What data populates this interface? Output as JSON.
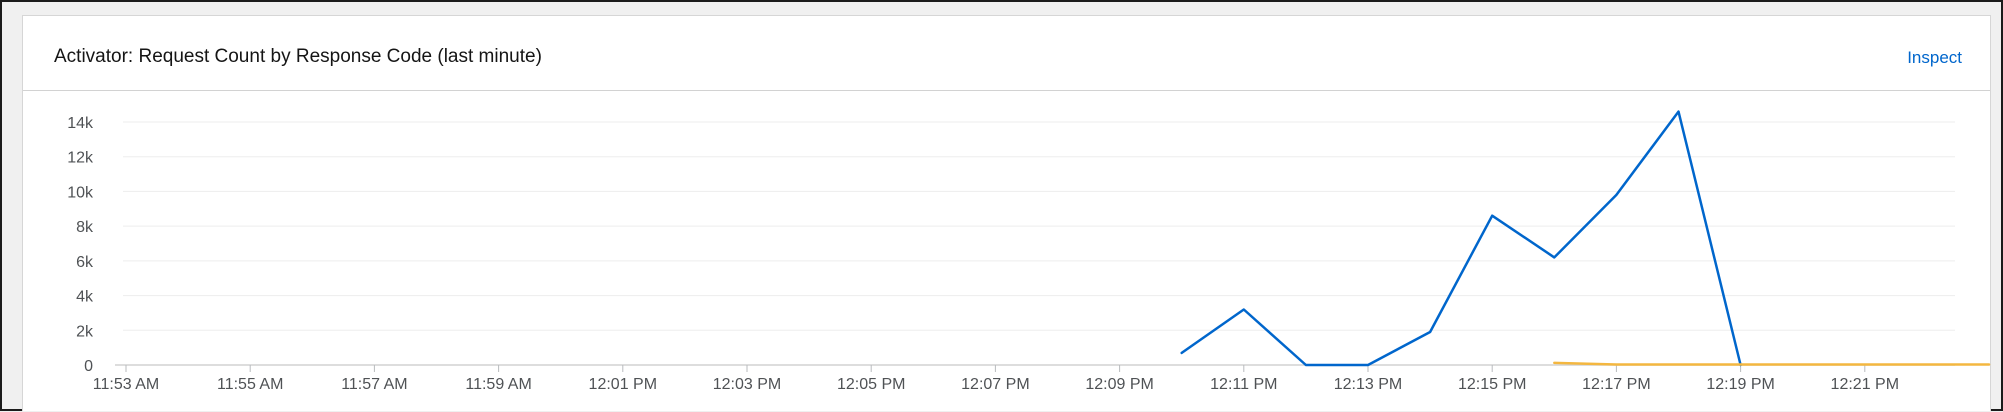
{
  "card": {
    "title": "Activator: Request Count by Response Code (last minute)",
    "inspect_label": "Inspect"
  },
  "colors": {
    "series_blue": "#0066cc",
    "series_orange": "#f4b740",
    "grid": "#ededed",
    "link": "#0066cc"
  },
  "chart_data": {
    "type": "line",
    "title": "Activator: Request Count by Response Code (last minute)",
    "xlabel": "",
    "ylabel": "",
    "ylim": [
      0,
      14000
    ],
    "y_ticks": [
      {
        "value": 0,
        "label": "0"
      },
      {
        "value": 2000,
        "label": "2k"
      },
      {
        "value": 4000,
        "label": "4k"
      },
      {
        "value": 6000,
        "label": "6k"
      },
      {
        "value": 8000,
        "label": "8k"
      },
      {
        "value": 10000,
        "label": "10k"
      },
      {
        "value": 12000,
        "label": "12k"
      },
      {
        "value": 14000,
        "label": "14k"
      }
    ],
    "x_ticks": [
      "11:53 AM",
      "11:55 AM",
      "11:57 AM",
      "11:59 AM",
      "12:01 PM",
      "12:03 PM",
      "12:05 PM",
      "12:07 PM",
      "12:09 PM",
      "12:11 PM",
      "12:13 PM",
      "12:15 PM",
      "12:17 PM",
      "12:19 PM",
      "12:21 PM"
    ],
    "series": [
      {
        "color": "#0066cc",
        "points": [
          {
            "x": "12:10 PM",
            "y": 700
          },
          {
            "x": "12:11 PM",
            "y": 3200
          },
          {
            "x": "12:12 PM",
            "y": 0
          },
          {
            "x": "12:13 PM",
            "y": 0
          },
          {
            "x": "12:14 PM",
            "y": 1900
          },
          {
            "x": "12:15 PM",
            "y": 8600
          },
          {
            "x": "12:16 PM",
            "y": 6200
          },
          {
            "x": "12:17 PM",
            "y": 9800
          },
          {
            "x": "12:18 PM",
            "y": 14600
          },
          {
            "x": "12:19 PM",
            "y": 0
          }
        ]
      },
      {
        "color": "#f4b740",
        "points": [
          {
            "x": "12:16 PM",
            "y": 120
          },
          {
            "x": "12:17 PM",
            "y": 30
          },
          {
            "x": "12:18 PM",
            "y": 30
          },
          {
            "x": "12:19 PM",
            "y": 30
          },
          {
            "x": "12:20 PM",
            "y": 30
          },
          {
            "x": "12:21 PM",
            "y": 30
          },
          {
            "x": "12:22 PM",
            "y": 30
          },
          {
            "x": "12:23 PM",
            "y": 30
          }
        ]
      }
    ],
    "grid": true,
    "legend": "none"
  }
}
